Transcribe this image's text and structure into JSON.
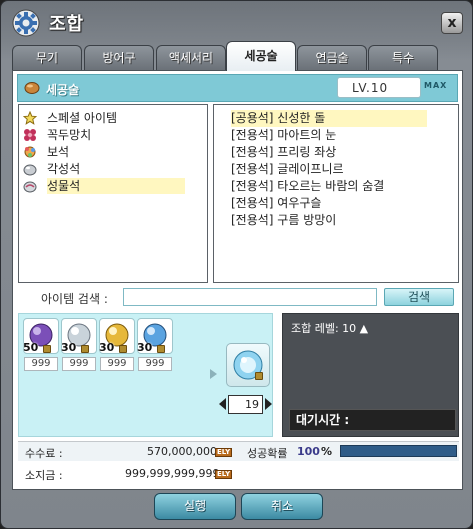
{
  "window": {
    "title": "조합",
    "close_label": "x"
  },
  "tabs": [
    {
      "label": "무기",
      "active": false
    },
    {
      "label": "방어구",
      "active": false
    },
    {
      "label": "액세서리",
      "active": false
    },
    {
      "label": "세공술",
      "active": true
    },
    {
      "label": "연금술",
      "active": false
    },
    {
      "label": "특수",
      "active": false
    }
  ],
  "skill": {
    "name": "세공술",
    "level": "LV.10",
    "max_badge": "MAX"
  },
  "categories": [
    {
      "label": "스페셜 아이템",
      "icon": "star-icon",
      "selected": false
    },
    {
      "label": "꼭두망치",
      "icon": "ribbon-icon",
      "selected": false
    },
    {
      "label": "보석",
      "icon": "gem-cluster-icon",
      "selected": false
    },
    {
      "label": "각성석",
      "icon": "stone-icon",
      "selected": false
    },
    {
      "label": "성물석",
      "icon": "relic-stone-icon",
      "selected": true
    }
  ],
  "recipes": [
    {
      "label": "[공용석] 신성한 돌",
      "selected": true
    },
    {
      "label": "[전용석] 마아트의 눈",
      "selected": false
    },
    {
      "label": "[전용석] 프리링 좌상",
      "selected": false
    },
    {
      "label": "[전용석] 글레이프니르",
      "selected": false
    },
    {
      "label": "[전용석] 타오르는 바람의 숨결",
      "selected": false
    },
    {
      "label": "[전용석] 여우구슬",
      "selected": false
    },
    {
      "label": "[전용석] 구름 방망이",
      "selected": false
    }
  ],
  "search": {
    "label": "아이템 검색 :",
    "value": "",
    "placeholder": "",
    "button_label": "검색"
  },
  "materials": [
    {
      "icon": "purple-orb-icon",
      "required": "50",
      "owned": "999",
      "color": "#7b4fb8"
    },
    {
      "icon": "silver-orb-icon",
      "required": "30",
      "owned": "999",
      "color": "#c9d3da"
    },
    {
      "icon": "gold-orb-icon",
      "required": "30",
      "owned": "999",
      "color": "#e6b83a"
    },
    {
      "icon": "blue-orb-icon",
      "required": "30",
      "owned": "999",
      "color": "#5aa3e0"
    }
  ],
  "result": {
    "icon": "holy-stone-icon",
    "quantity": "19"
  },
  "info": {
    "craft_level_label": "조합 레벨: 10 ▲",
    "wait_label": "대기시간 :"
  },
  "fee": {
    "label": "수수료 :",
    "value": "570,000,000",
    "currency": "ELY"
  },
  "success": {
    "label": "성공확률",
    "value": "100",
    "unit": "%",
    "fraction": 1.0
  },
  "balance": {
    "label": "소지금 :",
    "value": "999,999,999,999",
    "currency": "ELY"
  },
  "buttons": {
    "execute": "실행",
    "cancel": "취소"
  }
}
